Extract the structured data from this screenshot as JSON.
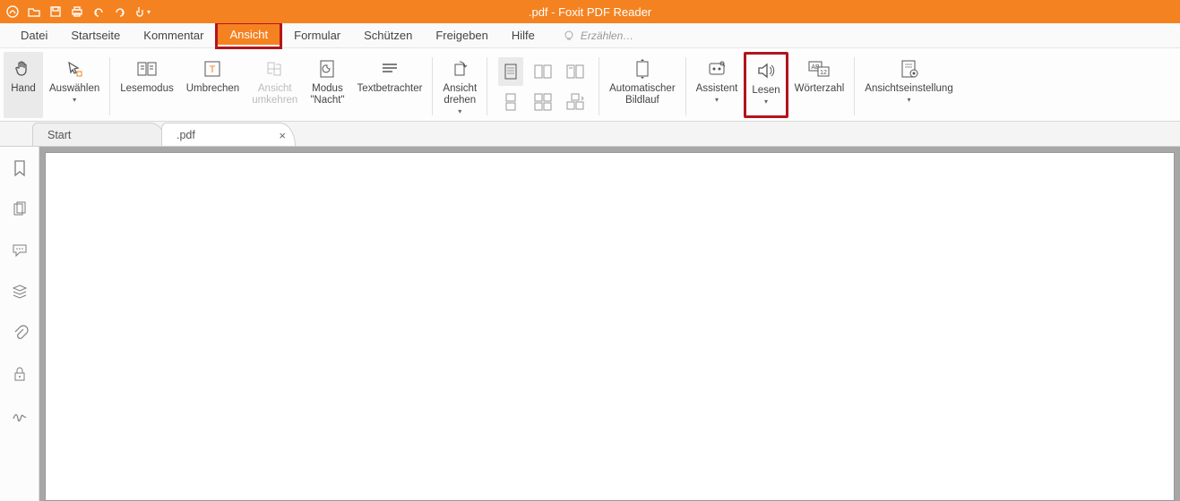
{
  "titlebar": {
    "title": ".pdf - Foxit PDF Reader"
  },
  "menubar": {
    "items": [
      "Datei",
      "Startseite",
      "Kommentar",
      "Ansicht",
      "Formular",
      "Schützen",
      "Freigeben",
      "Hilfe"
    ],
    "active_index": 3,
    "search_placeholder": "Erzählen…"
  },
  "ribbon": {
    "buttons": [
      {
        "label": "Hand",
        "icon": "hand",
        "active": true
      },
      {
        "label": "Auswählen",
        "icon": "select",
        "dropdown": true
      },
      {
        "label": "Lesemodus",
        "icon": "book"
      },
      {
        "label": "Umbrechen",
        "icon": "reflow"
      },
      {
        "label": "Ansicht\numkehren",
        "icon": "invert",
        "disabled": true
      },
      {
        "label": "Modus\n\"Nacht\"",
        "icon": "night"
      },
      {
        "label": "Textbetrachter",
        "icon": "textview"
      },
      {
        "label": "Ansicht\ndrehen",
        "icon": "rotate",
        "dropdown": true
      },
      {
        "label": "Automatischer\nBildlauf",
        "icon": "autoscroll"
      },
      {
        "label": "Assistent",
        "icon": "assistant",
        "dropdown": true
      },
      {
        "label": "Lesen",
        "icon": "speaker",
        "dropdown": true,
        "highlight": true
      },
      {
        "label": "Wörterzahl",
        "icon": "wordcount"
      },
      {
        "label": "Ansichtseinstellung",
        "icon": "viewsettings",
        "dropdown": true
      }
    ]
  },
  "doctabs": {
    "tabs": [
      {
        "label": "Start",
        "closable": false,
        "active": false
      },
      {
        "label": ".pdf",
        "closable": true,
        "active": true
      }
    ]
  },
  "sidepanel": {
    "items": [
      "bookmark",
      "pages",
      "comments",
      "layers",
      "attachments",
      "security",
      "signature"
    ]
  }
}
